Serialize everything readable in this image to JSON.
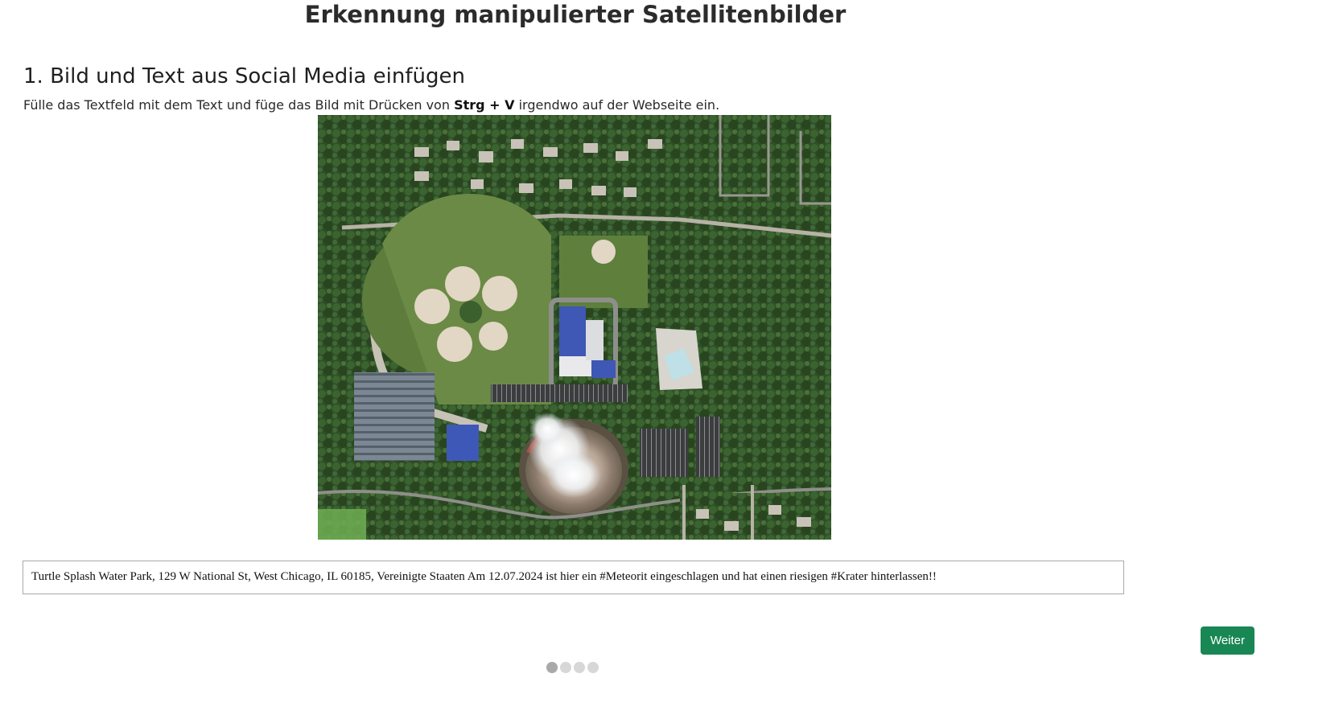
{
  "page": {
    "title": "Erkennung manipulierter Satellitenbilder"
  },
  "step": {
    "heading": "1. Bild und Text aus Social Media einfügen",
    "instruction_before": "Fülle das Textfeld mit dem Text und füge das Bild mit Drücken von ",
    "instruction_key": "Strg + V",
    "instruction_after": " irgendwo auf der Webseite ein."
  },
  "image": {
    "icon": "satellite-image"
  },
  "text_field": {
    "value": "Turtle Splash Water Park, 129 W National St, West Chicago, IL 60185, Vereinigte Staaten Am 12.07.2024 ist hier ein #Meteorit eingeschlagen und hat einen riesigen #Krater hinterlassen!!"
  },
  "buttons": {
    "next_label": "Weiter",
    "next_color": "#198754"
  },
  "pager": {
    "total": 4,
    "active": 1
  }
}
